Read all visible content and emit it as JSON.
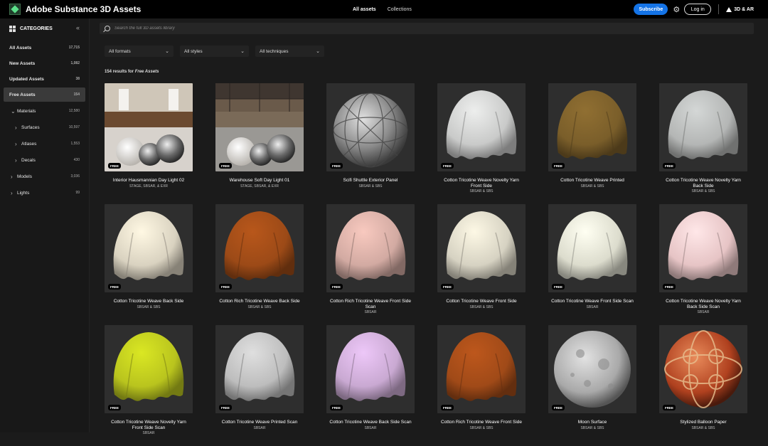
{
  "app": {
    "title": "Adobe Substance 3D Assets"
  },
  "topnav": [
    {
      "label": "All assets",
      "active": true
    },
    {
      "label": "Collections",
      "active": false
    }
  ],
  "header": {
    "subscribe": "Subscribe",
    "login": "Log in",
    "adobe_ar": "3D & AR"
  },
  "sidebar": {
    "title": "CATEGORIES",
    "items": [
      {
        "label": "All Assets",
        "count": "17,715"
      },
      {
        "label": "New Assets",
        "count": "1,082"
      },
      {
        "label": "Updated Assets",
        "count": "38"
      },
      {
        "label": "Free Assets",
        "count": "154"
      },
      {
        "label": "Materials",
        "count": "12,580"
      },
      {
        "label": "Surfaces",
        "count": "10,597"
      },
      {
        "label": "Atlases",
        "count": "1,553"
      },
      {
        "label": "Decals",
        "count": "430"
      },
      {
        "label": "Models",
        "count": "3,036"
      },
      {
        "label": "Lights",
        "count": "99"
      }
    ]
  },
  "search": {
    "placeholder": "Search the full 3D assets library"
  },
  "filters": [
    {
      "label": "All formats"
    },
    {
      "label": "All styles"
    },
    {
      "label": "All techniques"
    }
  ],
  "results": {
    "prefix": "154 results for ",
    "query": "Free Assets"
  },
  "badge_label": "FREE",
  "cards": [
    {
      "title": "Interior Hausmannian Day Light 02",
      "sub": "STAGE, SBSAR, & EXR",
      "kind": "light-int"
    },
    {
      "title": "Warehouse Soft Day Light 01",
      "sub": "STAGE, SBSAR, & EXR",
      "kind": "light-wh"
    },
    {
      "title": "Scifi Shuttle Exterior Panel",
      "sub": "SBSAR & SBS",
      "kind": "sphere-metal"
    },
    {
      "title": "Cotton Tricotine Weave Novelty Yarn Front Side",
      "sub": "SBSAR & SBS",
      "kind": "cloth",
      "color": "#c9cac9"
    },
    {
      "title": "Cotton Tricotine Weave Printed",
      "sub": "SBSAR & SBS",
      "kind": "cloth",
      "color": "#7a5e2a"
    },
    {
      "title": "Cotton Tricotine Weave Novelty Yarn Back Side",
      "sub": "SBSAR & SBS",
      "kind": "cloth",
      "color": "#b4b6b5"
    },
    {
      "title": "Cotton Tricotine Weave Back Side",
      "sub": "SBSAR & SBS",
      "kind": "cloth",
      "color": "#d9d2c0"
    },
    {
      "title": "Cotton Rich Tricotine Weave Back Side",
      "sub": "SBSAR & SBS",
      "kind": "cloth",
      "color": "#9c4a17"
    },
    {
      "title": "Cotton Rich Tricotine Weave Front Side Scan",
      "sub": "SBSAR",
      "kind": "cloth",
      "color": "#d2aaa2"
    },
    {
      "title": "Cotton Tricotine Weave Front Side",
      "sub": "SBSAR & SBS",
      "kind": "cloth",
      "color": "#d6d2c2"
    },
    {
      "title": "Cotton Tricotine Weave Front Side Scan",
      "sub": "SBSAR",
      "kind": "cloth",
      "color": "#dcdccd"
    },
    {
      "title": "Cotton Tricotine Weave Novelty Yarn Back Side Scan",
      "sub": "SBSAR",
      "kind": "cloth",
      "color": "#e6c4c5"
    },
    {
      "title": "Cotton Tricotine Weave Novelty Yarn Front Side Scan",
      "sub": "SBSAR",
      "kind": "cloth",
      "color": "#b9c41e"
    },
    {
      "title": "Cotton Tricotine Weave Printed Scan",
      "sub": "SBSAR",
      "kind": "cloth",
      "color": "#bdbdbd"
    },
    {
      "title": "Cotton Tricotine Weave Back Side Scan",
      "sub": "SBSAR",
      "kind": "cloth",
      "color": "#c9a9d2"
    },
    {
      "title": "Cotton Rich Tricotine Weave Front Side",
      "sub": "SBSAR & SBS",
      "kind": "cloth",
      "color": "#a04a18"
    },
    {
      "title": "Moon Surface",
      "sub": "SBSAR & SBS",
      "kind": "sphere-moon"
    },
    {
      "title": "Stylized Balloon Paper",
      "sub": "SBSAR & SBS",
      "kind": "sphere-balloon"
    }
  ]
}
